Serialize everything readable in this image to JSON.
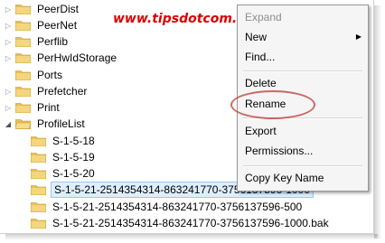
{
  "watermark": "www.tipsdotcom.com",
  "tree": {
    "items": [
      {
        "label": "PeerDist",
        "expander": "▷"
      },
      {
        "label": "PeerNet",
        "expander": "▷"
      },
      {
        "label": "Perflib",
        "expander": "▷"
      },
      {
        "label": "PerHwIdStorage",
        "expander": "▷"
      },
      {
        "label": "Ports",
        "expander": ""
      },
      {
        "label": "Prefetcher",
        "expander": "▷"
      },
      {
        "label": "Print",
        "expander": "▷"
      },
      {
        "label": "ProfileList",
        "expander": "◢"
      },
      {
        "label": "S-1-5-18",
        "expander": ""
      },
      {
        "label": "S-1-5-19",
        "expander": ""
      },
      {
        "label": "S-1-5-20",
        "expander": ""
      },
      {
        "label": "S-1-5-21-2514354314-863241770-3756137596-1000",
        "expander": ""
      },
      {
        "label": "S-1-5-21-2514354314-863241770-3756137596-500",
        "expander": ""
      },
      {
        "label": "S-1-5-21-2514354314-863241770-3756137596-1000.bak",
        "expander": ""
      }
    ]
  },
  "context_menu": {
    "expand": "Expand",
    "new": "New",
    "find": "Find...",
    "delete": "Delete",
    "rename": "Rename",
    "export": "Export",
    "permissions": "Permissions...",
    "copy_key_name": "Copy Key Name"
  },
  "colors": {
    "watermark": "#d90000",
    "selection_bg": "#dfeefc",
    "selection_border": "#99c8f2",
    "highlight_oval": "#c0504d",
    "folder": "#e9c053"
  },
  "icons": {
    "folder": "folder-icon",
    "collapsed": "triangle-right-icon",
    "expanded": "triangle-down-icon",
    "submenu": "chevron-right-icon"
  }
}
